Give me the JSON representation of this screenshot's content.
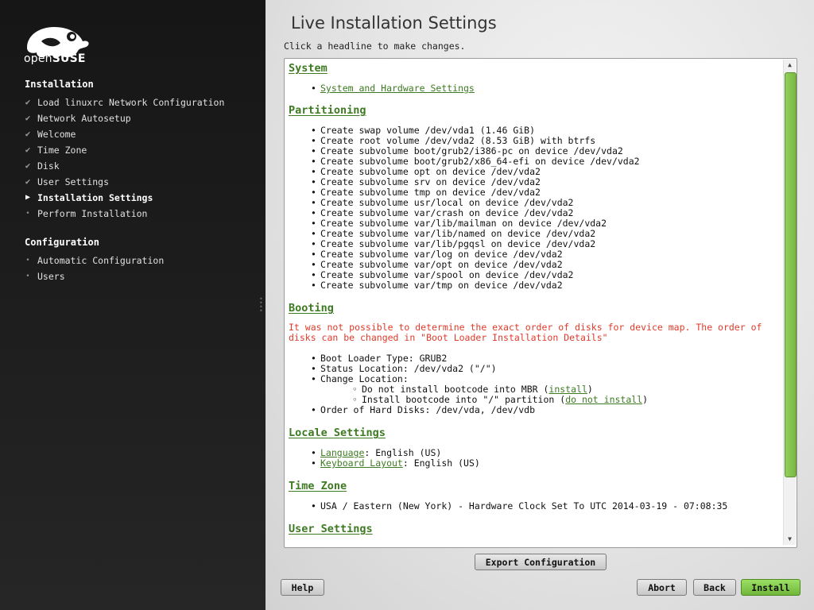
{
  "sidebar": {
    "logo_text_light": "open",
    "logo_text_bold": "SUSE",
    "installation_title": "Installation",
    "installation_steps": [
      {
        "label": "Load linuxrc Network Configuration",
        "state": "done"
      },
      {
        "label": "Network Autosetup",
        "state": "done"
      },
      {
        "label": "Welcome",
        "state": "done"
      },
      {
        "label": "Time Zone",
        "state": "done"
      },
      {
        "label": "Disk",
        "state": "done"
      },
      {
        "label": "User Settings",
        "state": "done"
      },
      {
        "label": "Installation Settings",
        "state": "current"
      },
      {
        "label": "Perform Installation",
        "state": "pending"
      }
    ],
    "configuration_title": "Configuration",
    "configuration_steps": [
      {
        "label": "Automatic Configuration",
        "state": "pending"
      },
      {
        "label": "Users",
        "state": "pending"
      }
    ]
  },
  "main": {
    "title": "Live Installation Settings",
    "hint": "Click a headline to make changes.",
    "sections": {
      "system": {
        "headline": "System",
        "items": [
          "System and Hardware Settings"
        ]
      },
      "partitioning": {
        "headline": "Partitioning",
        "items": [
          "Create swap volume /dev/vda1 (1.46 GiB)",
          "Create root volume /dev/vda2 (8.53 GiB) with btrfs",
          "Create subvolume boot/grub2/i386-pc on device /dev/vda2",
          "Create subvolume boot/grub2/x86_64-efi on device /dev/vda2",
          "Create subvolume opt on device /dev/vda2",
          "Create subvolume srv on device /dev/vda2",
          "Create subvolume tmp on device /dev/vda2",
          "Create subvolume usr/local on device /dev/vda2",
          "Create subvolume var/crash on device /dev/vda2",
          "Create subvolume var/lib/mailman on device /dev/vda2",
          "Create subvolume var/lib/named on device /dev/vda2",
          "Create subvolume var/lib/pgqsl on device /dev/vda2",
          "Create subvolume var/log on device /dev/vda2",
          "Create subvolume var/opt on device /dev/vda2",
          "Create subvolume var/spool on device /dev/vda2",
          "Create subvolume var/tmp on device /dev/vda2"
        ]
      },
      "booting": {
        "headline": "Booting",
        "warning": "It was not possible to determine the exact order of disks for device map. The order of disks can be changed in \"Boot Loader Installation Details\"",
        "boot_loader_type": "Boot Loader Type: GRUB2",
        "status_location": "Status Location: /dev/vda2 (\"/\")",
        "change_location": "Change Location:",
        "mbr_text": "Do not install bootcode into MBR (",
        "mbr_link": "install",
        "mbr_close": ")",
        "partition_text": "Install bootcode into \"/\" partition (",
        "partition_link": "do not install",
        "partition_close": ")",
        "disk_order": "Order of Hard Disks: /dev/vda, /dev/vdb"
      },
      "locale": {
        "headline": "Locale Settings",
        "language_link": "Language",
        "language_value": ": English (US)",
        "keyboard_link": "Keyboard Layout",
        "keyboard_value": ": English (US)"
      },
      "timezone": {
        "headline": "Time Zone",
        "value": "USA / Eastern (New York) - Hardware Clock Set To UTC 2014-03-19 - 07:08:35"
      },
      "users": {
        "headline": "User Settings"
      }
    },
    "buttons": {
      "export": "Export Configuration",
      "help": "Help",
      "abort": "Abort",
      "back": "Back",
      "install": "Install"
    }
  },
  "colors": {
    "accent_green": "#3d7a22",
    "warning_red": "#e03a2a",
    "primary_button": "#7ab843"
  }
}
